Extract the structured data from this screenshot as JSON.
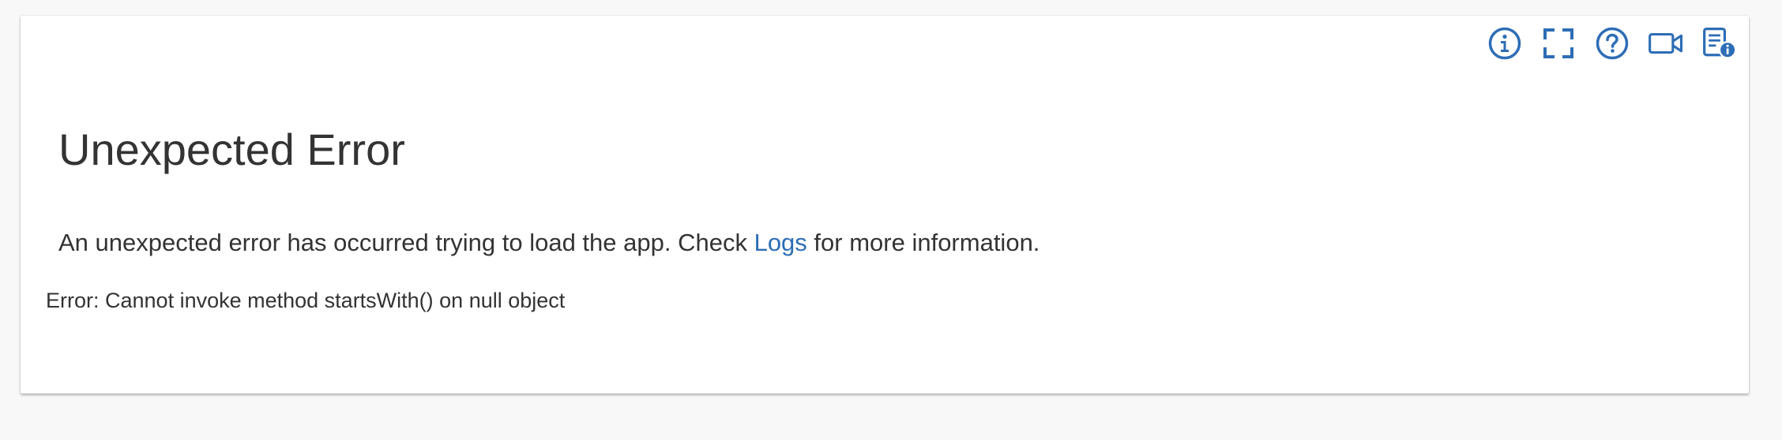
{
  "toolbar": {
    "icons": [
      "info-icon",
      "fullscreen-icon",
      "help-icon",
      "video-icon",
      "logs-info-icon"
    ],
    "accent_color": "#2d6db5"
  },
  "error": {
    "title": "Unexpected Error",
    "message_before": "An unexpected error has occurred trying to load the app. Check ",
    "logs_link": "Logs",
    "message_after": " for more information.",
    "detail": "Error: Cannot invoke method startsWith() on null object"
  }
}
